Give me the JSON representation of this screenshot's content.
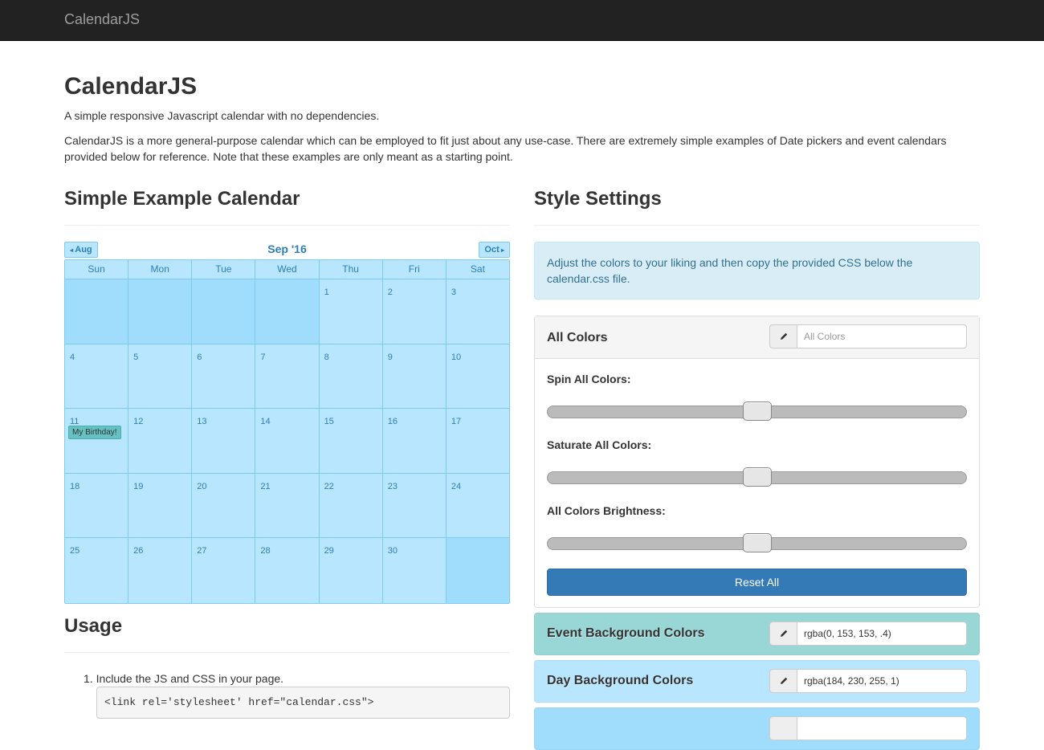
{
  "navbar": {
    "brand": "CalendarJS"
  },
  "header": {
    "title": "CalendarJS",
    "lead": "A simple responsive Javascript calendar with no dependencies.",
    "description": "CalendarJS is a more general-purpose calendar which can be employed to fit just about any use-case. There are extremely simple examples of Date pickers and event calendars provided below for reference. Note that these examples are only meant as a starting point."
  },
  "calendar_section": {
    "title": "Simple Example Calendar",
    "prev_label": "Aug",
    "next_label": "Oct",
    "month_label": "Sep '16",
    "weekdays": [
      "Sun",
      "Mon",
      "Tue",
      "Wed",
      "Thu",
      "Fri",
      "Sat"
    ],
    "weeks": [
      [
        "",
        "",
        "",
        "",
        "1",
        "2",
        "3"
      ],
      [
        "4",
        "5",
        "6",
        "7",
        "8",
        "9",
        "10"
      ],
      [
        "11",
        "12",
        "13",
        "14",
        "15",
        "16",
        "17"
      ],
      [
        "18",
        "19",
        "20",
        "21",
        "22",
        "23",
        "24"
      ],
      [
        "25",
        "26",
        "27",
        "28",
        "29",
        "30",
        ""
      ]
    ],
    "event": {
      "day": "11",
      "label": "My Birthday!"
    }
  },
  "usage": {
    "title": "Usage",
    "step_1": "Include the JS and CSS in your page.",
    "code_1": "<link rel='stylesheet' href=\"calendar.css\">"
  },
  "style_settings": {
    "title": "Style Settings",
    "info": "Adjust the colors to your liking and then copy the provided CSS below the calendar.css file.",
    "all_colors": {
      "title": "All Colors",
      "placeholder": "All Colors",
      "spin_label": "Spin All Colors:",
      "saturate_label": "Saturate All Colors:",
      "brightness_label": "All Colors Brightness:",
      "spin_value": 0.5,
      "saturate_value": 0.5,
      "brightness_value": 0.5,
      "reset_label": "Reset All"
    },
    "event_bg": {
      "title": "Event Background Colors",
      "value": "rgba(0, 153, 153, .4)",
      "color": "#99d6d6"
    },
    "day_bg": {
      "title": "Day Background Colors",
      "value": "rgba(184, 230, 255, 1)",
      "color": "#b8e6ff"
    },
    "next_panel_color": "#a0dcfb"
  },
  "icons": {
    "pencil": "pencil-icon",
    "prev_arrow": "arrow-left-icon",
    "next_arrow": "arrow-right-icon"
  }
}
